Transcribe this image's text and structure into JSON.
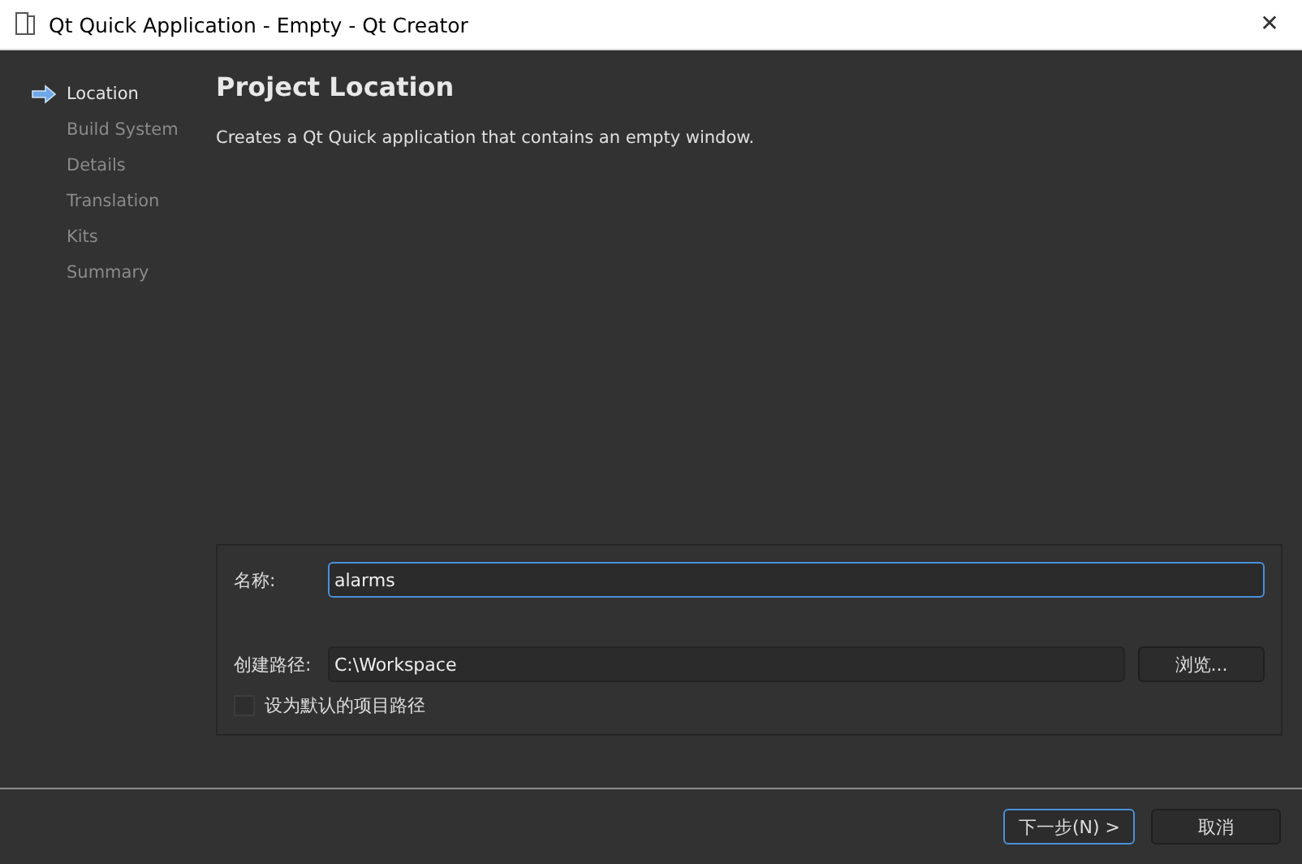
{
  "window": {
    "title": "Qt Quick Application - Empty - Qt Creator",
    "close": "✕"
  },
  "steps": [
    {
      "label": "Location",
      "selected": true
    },
    {
      "label": "Build System",
      "selected": false
    },
    {
      "label": "Details",
      "selected": false
    },
    {
      "label": "Translation",
      "selected": false
    },
    {
      "label": "Kits",
      "selected": false
    },
    {
      "label": "Summary",
      "selected": false
    }
  ],
  "page": {
    "title": "Project Location",
    "description": "Creates a Qt Quick application that contains an empty window."
  },
  "form": {
    "name_label": "名称:",
    "name_value": "alarms",
    "path_label": "创建路径:",
    "path_value": "C:\\Workspace",
    "browse": "浏览...",
    "default_checkbox": {
      "label": "设为默认的项目路径",
      "checked": false
    }
  },
  "buttons": [
    {
      "label": "下一步(N) >",
      "default": true
    },
    {
      "label": "取消",
      "default": false
    }
  ]
}
